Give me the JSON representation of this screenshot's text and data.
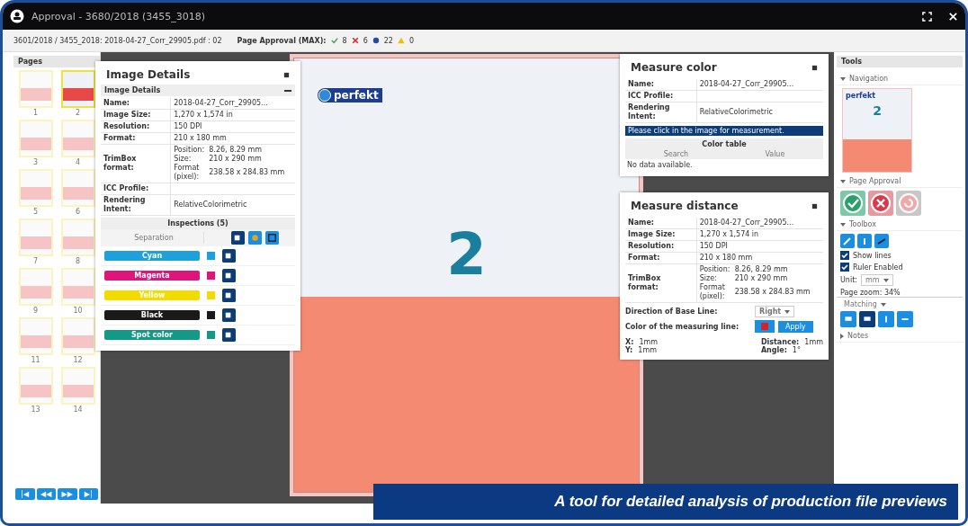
{
  "window": {
    "title": "Approval - 3680/2018 (3455_3018)"
  },
  "subbar": {
    "path": "3601/2018 / 3455_2018: 2018-04-27_Corr_29905.pdf : 02",
    "approval_label": "Page Approval (MAX):",
    "counts": [
      {
        "kind": "approved",
        "value": "8"
      },
      {
        "kind": "rejected",
        "value": "6"
      },
      {
        "kind": "pending",
        "value": "22"
      },
      {
        "kind": "warning",
        "value": "0"
      }
    ]
  },
  "pages": {
    "title": "Pages",
    "items": [
      {
        "label": "1",
        "selected": false
      },
      {
        "label": "2",
        "selected": true
      },
      {
        "label": "3",
        "selected": false
      },
      {
        "label": "4",
        "selected": false
      },
      {
        "label": "5",
        "selected": false
      },
      {
        "label": "6",
        "selected": false
      },
      {
        "label": "7",
        "selected": false
      },
      {
        "label": "8",
        "selected": false
      },
      {
        "label": "9",
        "selected": false
      },
      {
        "label": "10",
        "selected": false
      },
      {
        "label": "11",
        "selected": false
      },
      {
        "label": "12",
        "selected": false
      },
      {
        "label": "13",
        "selected": false
      },
      {
        "label": "14",
        "selected": false
      }
    ],
    "nav_buttons": [
      "|◀",
      "◀◀",
      "▶▶",
      "▶|"
    ]
  },
  "canvas": {
    "logo": "perfekt",
    "page_number": "2"
  },
  "image_details": {
    "title": "Image Details",
    "section": "Image Details",
    "rows": [
      {
        "label": "Name:",
        "value": "2018-04-27_Corr_29905..."
      },
      {
        "label": "Image Size:",
        "value": "1,270 x 1,574 in"
      },
      {
        "label": "Resolution:",
        "value": "150 DPI"
      },
      {
        "label": "Format:",
        "value": "210 x 180 mm"
      },
      {
        "label": "TrimBox format:",
        "sub": [
          {
            "label": "Position:",
            "value": "8.26, 8.29 mm"
          },
          {
            "label": "Size:",
            "value": "210 x 290 mm"
          },
          {
            "label": "Format (pixel):",
            "value": "238.58 x 284.83 mm"
          }
        ]
      },
      {
        "label": "ICC Profile:",
        "value": ""
      },
      {
        "label": "Rendering Intent:",
        "value": "RelativeColorimetric"
      }
    ],
    "inspections_title": "Inspections (5)",
    "separation_header": "Separation",
    "separations": [
      {
        "name": "Cyan",
        "color": "#1ea0dc"
      },
      {
        "name": "Magenta",
        "color": "#e0157a"
      },
      {
        "name": "Yellow",
        "color": "#f2dc00"
      },
      {
        "name": "Black",
        "color": "#1a1a1a"
      },
      {
        "name": "Spot color",
        "color": "#139a86"
      }
    ]
  },
  "measure_color": {
    "title": "Measure color",
    "rows": [
      {
        "label": "Name:",
        "value": "2018-04-27_Corr_29905..."
      },
      {
        "label": "ICC Profile:",
        "value": ""
      },
      {
        "label": "Rendering Intent:",
        "value": "RelativeColorimetric"
      }
    ],
    "notice": "Please click in the image for measurement.",
    "table_title": "Color table",
    "columns": [
      "Search",
      "Value"
    ],
    "empty": "No data available."
  },
  "measure_distance": {
    "title": "Measure distance",
    "rows": [
      {
        "label": "Name:",
        "value": "2018-04-27_Corr_29905..."
      },
      {
        "label": "Image Size:",
        "value": "1,270 x 1,574 in"
      },
      {
        "label": "Resolution:",
        "value": "150 DPI"
      },
      {
        "label": "Format:",
        "value": "210 x 180 mm"
      },
      {
        "label": "TrimBox format:",
        "sub": [
          {
            "label": "Position:",
            "value": "8.26, 8.29 mm"
          },
          {
            "label": "Size:",
            "value": "210 x 290 mm"
          },
          {
            "label": "Format (pixel):",
            "value": "238.58 x 284.83 mm"
          }
        ]
      }
    ],
    "direction_label": "Direction of Base Line:",
    "direction_value": "Right",
    "line_color_label": "Color of the measuring line:",
    "apply": "Apply",
    "readings": [
      {
        "label": "X:",
        "value": "1mm"
      },
      {
        "label": "Y:",
        "value": "1mm"
      }
    ],
    "results": [
      {
        "label": "Distance:",
        "value": "1mm"
      },
      {
        "label": "Angle:",
        "value": "1°"
      }
    ]
  },
  "tools": {
    "title": "Tools",
    "navigation": {
      "label": "Navigation",
      "expanded": true
    },
    "nav_logo": "perfekt",
    "nav_page": "2",
    "page_approval": {
      "label": "Page Approval",
      "expanded": true
    },
    "toolbox": {
      "label": "Toolbox",
      "expanded": true
    },
    "checks": [
      {
        "label": "Show lines",
        "checked": true
      },
      {
        "label": "Ruler Enabled",
        "checked": true
      }
    ],
    "unit_label": "Unit:",
    "unit_value": "mm",
    "zoom_label": "Page zoom: 34%",
    "matching": "Matching",
    "notes": {
      "label": "Notes",
      "expanded": false
    }
  },
  "caption": "A tool for detailed analysis of production file previews"
}
